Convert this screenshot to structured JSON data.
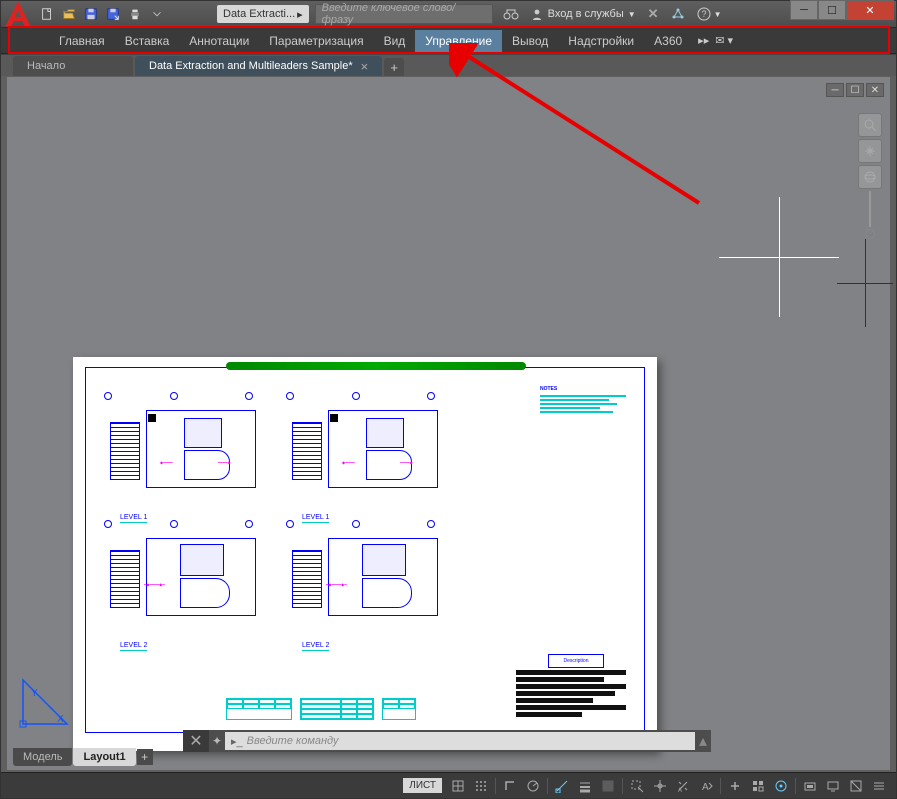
{
  "title_doc": "Data Extracti...",
  "search_placeholder": "Введите ключевое слово/фразу",
  "signin_label": "Вход в службы",
  "ribbon_tabs": [
    "Главная",
    "Вставка",
    "Аннотации",
    "Параметризация",
    "Вид",
    "Управление",
    "Вывод",
    "Надстройки",
    "A360"
  ],
  "ribbon_active_index": 5,
  "file_tabs": {
    "start": "Начало",
    "active": "Data Extraction and Multileaders Sample*"
  },
  "layout_tabs": {
    "model": "Модель",
    "active": "Layout1"
  },
  "status_label": "ЛИСТ",
  "cmd_placeholder": "Введите команду",
  "paper": {
    "levels": [
      "LEVEL 1",
      "LEVEL 1",
      "LEVEL 2",
      "LEVEL 2"
    ],
    "notes_title": "NOTES",
    "rev": "Description"
  },
  "icons": {
    "qat": [
      "new-icon",
      "open-icon",
      "save-icon",
      "saveas-icon",
      "print-icon",
      "more-icon"
    ],
    "title_right": [
      "binoculars-icon",
      "user-icon",
      "exchange-icon",
      "help-icon"
    ],
    "viewcube": [
      "zoom-extents-icon",
      "pan-icon",
      "orbit-icon"
    ],
    "status": [
      "grid-icon",
      "snap-icon",
      "ortho-icon",
      "polar-icon",
      "osnap-icon",
      "osnap3d-icon",
      "lineweight-icon",
      "transparency-icon",
      "selection-icon",
      "gizmo-icon",
      "annoscale-icon",
      "annovis-icon",
      "annoadd-icon",
      "workspace-icon",
      "monitor-icon",
      "isolate-icon",
      "hardware-icon",
      "clean-icon",
      "custom-icon"
    ]
  }
}
